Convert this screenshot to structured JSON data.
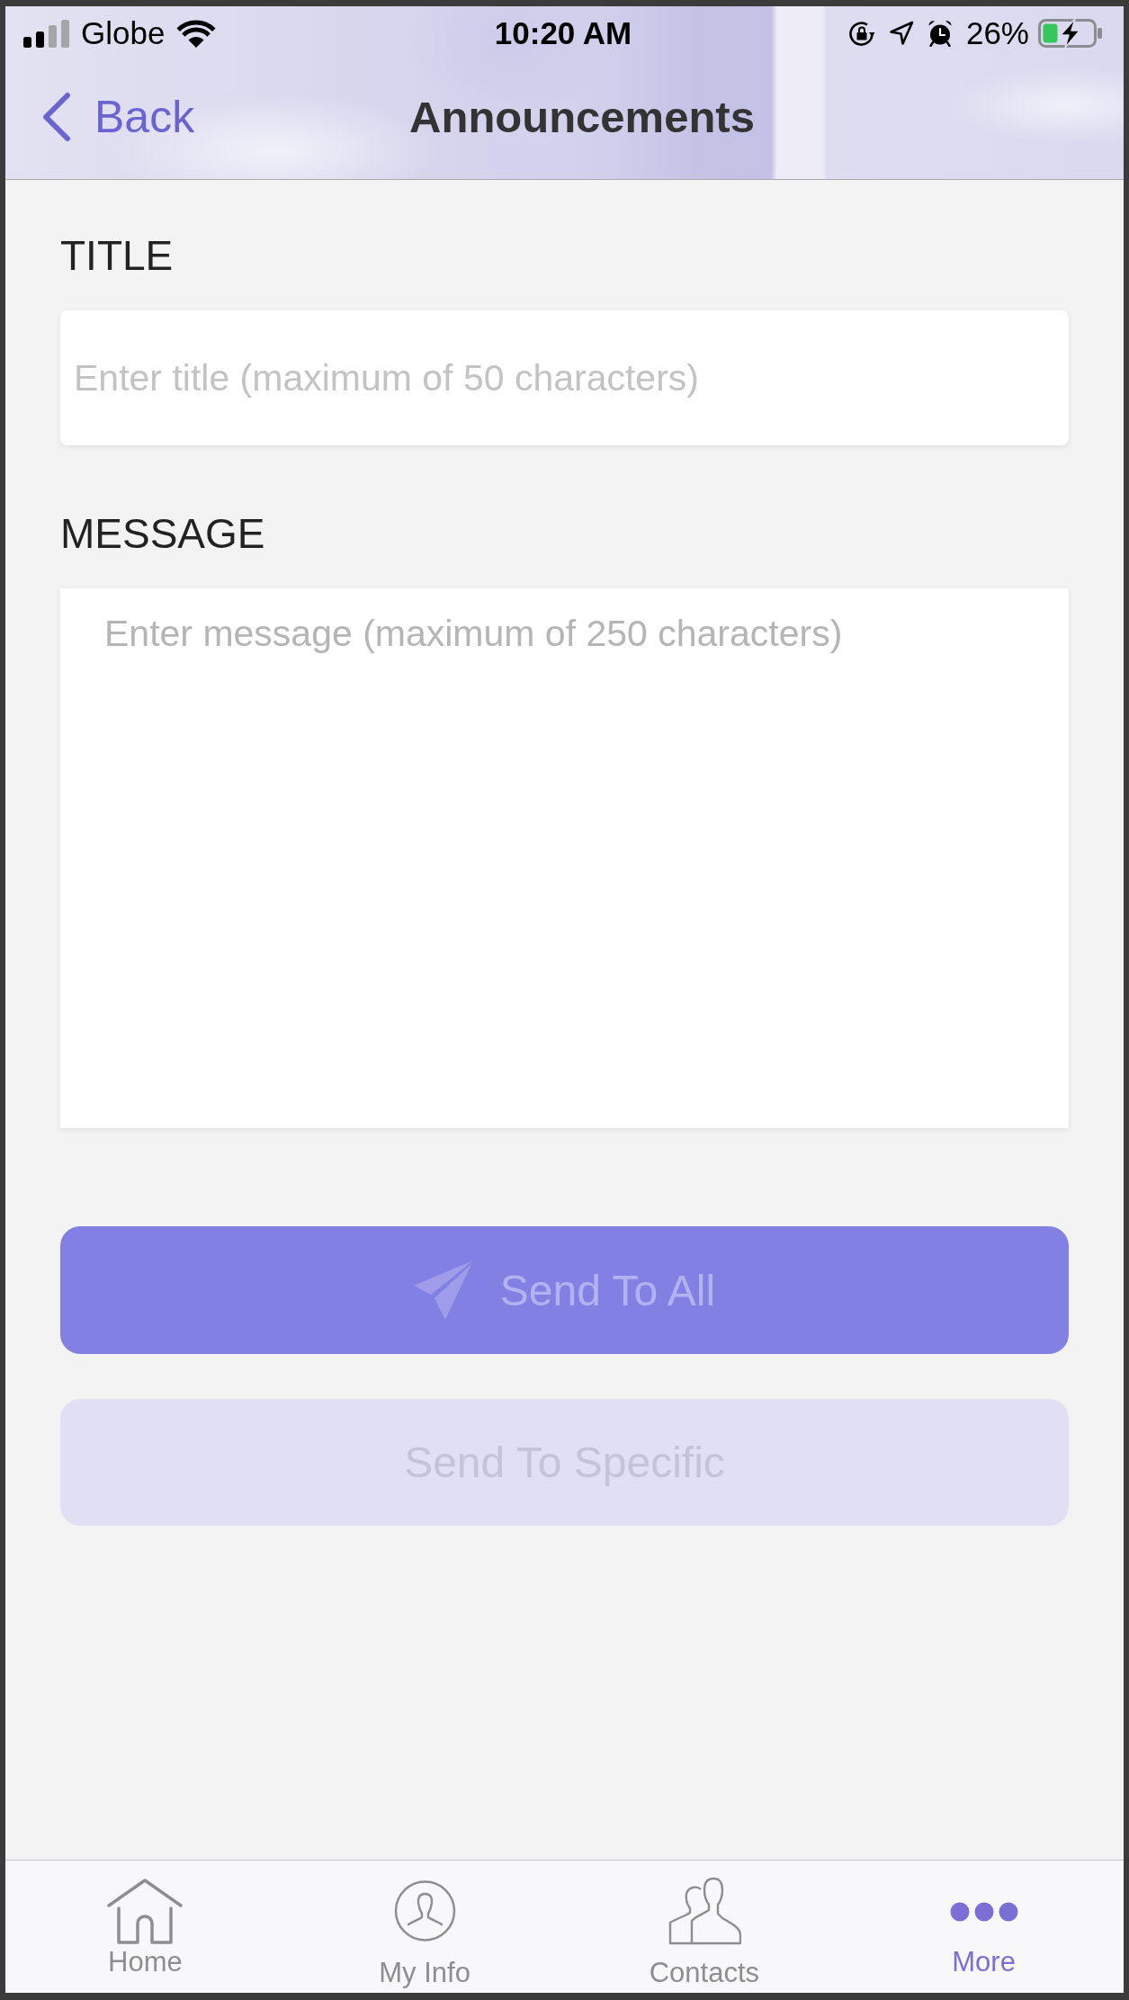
{
  "status_bar": {
    "carrier": "Globe",
    "time": "10:20 AM",
    "battery": "26%"
  },
  "nav_bar": {
    "back": "Back",
    "title": "Announcements"
  },
  "form": {
    "fields": [
      {
        "label": "TITLE",
        "kind": "single",
        "placeholder": "Enter title (maximum of 50 characters)"
      },
      {
        "label": "MESSAGE",
        "kind": "multi",
        "placeholder": "Enter message (maximum of 250 characters)"
      }
    ]
  },
  "buttons": [
    {
      "label": "Send To All",
      "kind": "primary",
      "disabled": true
    },
    {
      "label": "Send To Specific",
      "kind": "secondary",
      "disabled": true
    }
  ],
  "tab_bar": {
    "tabs": [
      {
        "label": "Home",
        "selected": false
      },
      {
        "label": "My Info",
        "selected": false
      },
      {
        "label": "Contacts",
        "selected": false
      },
      {
        "label": "More",
        "selected": true
      }
    ]
  }
}
